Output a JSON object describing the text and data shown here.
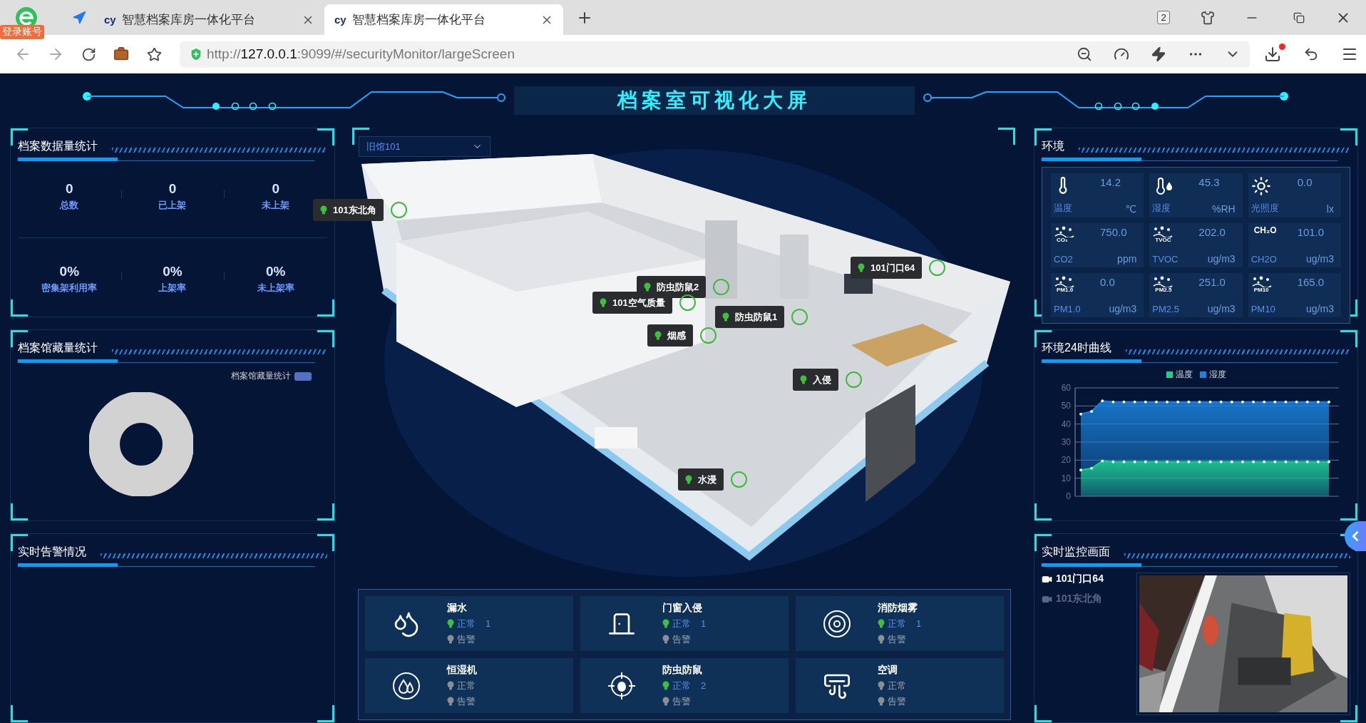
{
  "browser": {
    "account_badge": "登录账号",
    "tabs": [
      {
        "icon_text": "cy",
        "title": "智慧档案库房一体化平台",
        "selected": false
      },
      {
        "icon_text": "cy",
        "title": "智慧档案库房一体化平台",
        "selected": true
      }
    ],
    "tab_count": "2",
    "url": "http://**127.0.0.1**:9099/#/securityMonitor/largeScreen",
    "download_badge": true
  },
  "screen": {
    "title": "档案室可视化大屏",
    "archive_stats": {
      "title": "档案数据量统计",
      "rows": [
        [
          {
            "value": "0",
            "label": "总数"
          },
          {
            "value": "0",
            "label": "已上架"
          },
          {
            "value": "0",
            "label": "未上架"
          }
        ],
        [
          {
            "value": "0%",
            "label": "密集架利用率"
          },
          {
            "value": "0%",
            "label": "上架率"
          },
          {
            "value": "0%",
            "label": "未上架率"
          }
        ]
      ]
    },
    "collection": {
      "title": "档案馆藏量统计",
      "legend": [
        {
          "label": "档案馆藏量统计",
          "color": "#5470c6"
        }
      ]
    },
    "alarms": {
      "title": "实时告警情况"
    },
    "room": {
      "selector": "旧馆101",
      "markers": [
        {
          "label": "101东北角"
        },
        {
          "label": "101门口64"
        },
        {
          "label": "防虫防鼠2"
        },
        {
          "label": "101空气质量"
        },
        {
          "label": "防虫防鼠1"
        },
        {
          "label": "烟感"
        },
        {
          "label": "入侵"
        },
        {
          "label": "水浸"
        }
      ]
    },
    "devices": [
      {
        "name": "漏水",
        "kind": "leak",
        "statuses": [
          {
            "label": "正常",
            "active": true,
            "count": "1"
          },
          {
            "label": "告警",
            "active": false
          }
        ]
      },
      {
        "name": "门窗入侵",
        "kind": "door",
        "statuses": [
          {
            "label": "正常",
            "active": true,
            "count": "1"
          },
          {
            "label": "告警",
            "active": false
          }
        ]
      },
      {
        "name": "消防烟雾",
        "kind": "smoke",
        "statuses": [
          {
            "label": "正常",
            "active": true,
            "count": "1"
          },
          {
            "label": "告警",
            "active": false
          }
        ]
      },
      {
        "name": "恒湿机",
        "kind": "humidifier",
        "statuses": [
          {
            "label": "正常",
            "active": false
          },
          {
            "label": "告警",
            "active": false
          }
        ]
      },
      {
        "name": "防虫防鼠",
        "kind": "pest",
        "statuses": [
          {
            "label": "正常",
            "active": true,
            "count": "2"
          },
          {
            "label": "告警",
            "active": false
          }
        ]
      },
      {
        "name": "空调",
        "kind": "aircon",
        "statuses": [
          {
            "label": "正常",
            "active": false
          },
          {
            "label": "告警",
            "active": false
          }
        ]
      }
    ],
    "environment": {
      "title": "环境",
      "sensors": [
        {
          "kind": "thermometer",
          "label": "温度",
          "value": "14.2",
          "unit": "℃"
        },
        {
          "kind": "hygrometer",
          "label": "湿度",
          "value": "45.3",
          "unit": "%RH"
        },
        {
          "kind": "light",
          "label": "光照度",
          "value": "0.0",
          "unit": "lx"
        },
        {
          "kind": "particles",
          "icon_caption": "CO₂",
          "label": "CO2",
          "value": "750.0",
          "unit": "ppm"
        },
        {
          "kind": "particles",
          "icon_caption": "TVOC",
          "label": "TVOC",
          "value": "202.0",
          "unit": "ug/m3"
        },
        {
          "kind": "formula",
          "icon_caption": "CH₂O",
          "label": "CH2O",
          "value": "101.0",
          "unit": "ug/m3"
        },
        {
          "kind": "particles",
          "icon_caption": "PM1.0",
          "label": "PM1.0",
          "value": "0.0",
          "unit": "ug/m3"
        },
        {
          "kind": "particles",
          "icon_caption": "PM2.5",
          "label": "PM2.5",
          "value": "251.0",
          "unit": "ug/m3"
        },
        {
          "kind": "particles",
          "icon_caption": "PM10",
          "label": "PM10",
          "value": "165.0",
          "unit": "ug/m3"
        }
      ]
    },
    "curve": {
      "title": "环境24时曲线",
      "chart_data": {
        "type": "area",
        "grid": true,
        "ylim": [
          0,
          60
        ],
        "yticks": [
          0,
          10,
          20,
          30,
          40,
          50,
          60
        ],
        "series": [
          {
            "name": "温度",
            "color": "#1ed18b",
            "values": [
              14.5,
              15.5,
              19.5,
              19,
              19,
              19,
              19,
              19,
              19,
              19,
              19,
              19,
              19,
              19,
              19,
              19,
              19,
              19,
              19,
              19,
              19,
              19,
              19,
              19
            ]
          },
          {
            "name": "湿度",
            "color": "#1a85e0",
            "values": [
              45.5,
              47,
              52.8,
              52.2,
              52.2,
              52.2,
              52.2,
              52.2,
              52.2,
              52.2,
              52.2,
              52.2,
              52.2,
              52.2,
              52.2,
              52.2,
              52.2,
              52.2,
              52.2,
              52.2,
              52.2,
              52.2,
              52.2,
              52.2
            ]
          }
        ]
      }
    },
    "monitor": {
      "title": "实时监控画面",
      "cameras": [
        {
          "name": "101门口64",
          "selected": true
        },
        {
          "name": "101东北角",
          "selected": false
        }
      ]
    }
  }
}
